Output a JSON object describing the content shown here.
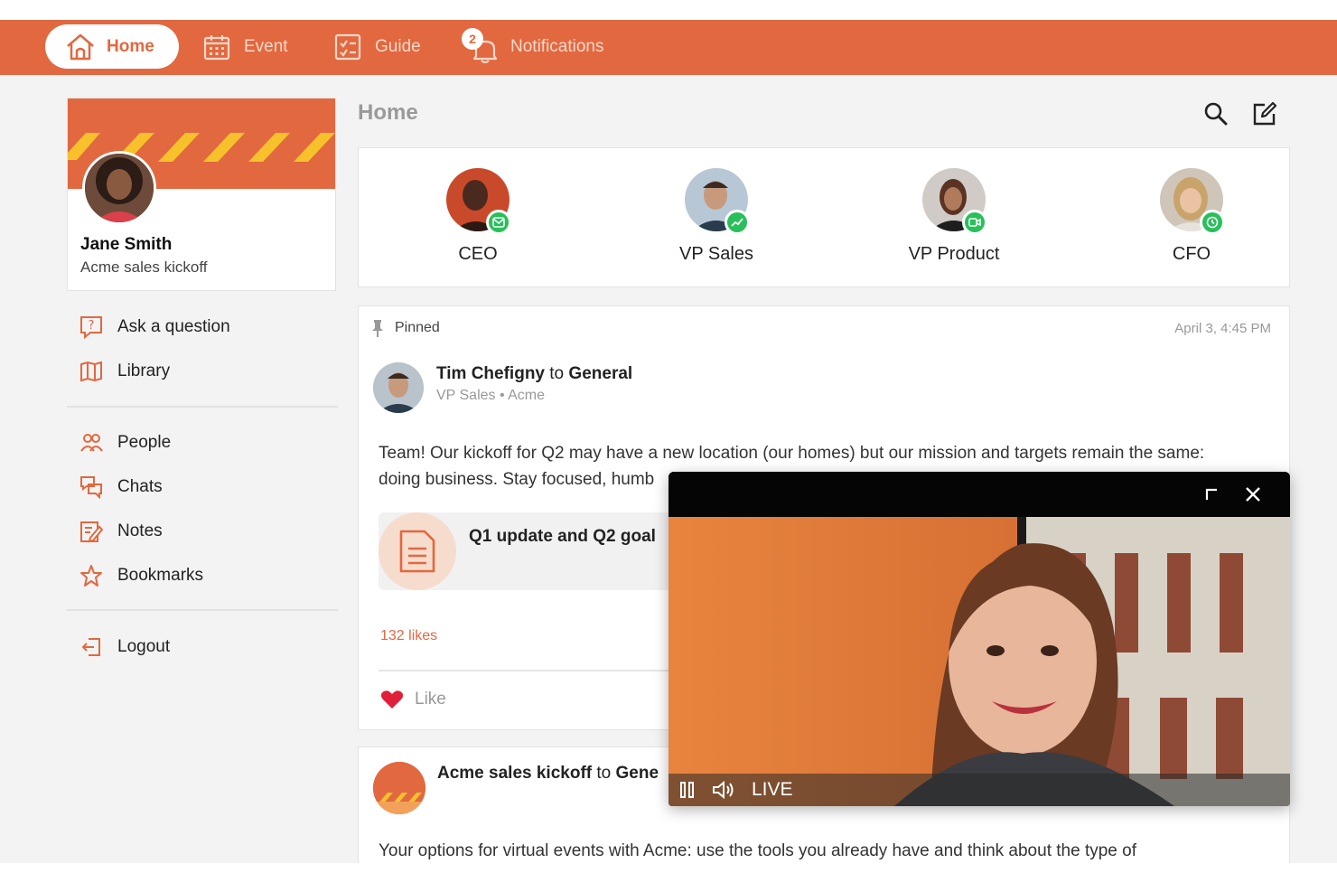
{
  "nav": {
    "home": "Home",
    "event": "Event",
    "guide": "Guide",
    "notifications": "Notifications",
    "notification_count": "2"
  },
  "profile": {
    "name": "Jane Smith",
    "subtitle": "Acme sales kickoff"
  },
  "sidebar": {
    "items": [
      {
        "label": "Ask a question",
        "icon": "question-icon"
      },
      {
        "label": "Library",
        "icon": "book-icon"
      },
      {
        "label": "People",
        "icon": "people-icon"
      },
      {
        "label": "Chats",
        "icon": "chat-icon"
      },
      {
        "label": "Notes",
        "icon": "notes-icon"
      },
      {
        "label": "Bookmarks",
        "icon": "star-icon"
      },
      {
        "label": "Logout",
        "icon": "logout-icon"
      }
    ]
  },
  "main": {
    "title": "Home",
    "search_icon": "search-icon",
    "compose_icon": "compose-icon"
  },
  "leaders": [
    {
      "label": "CEO",
      "status_icon": "mail-icon"
    },
    {
      "label": "VP Sales",
      "status_icon": "trend-icon"
    },
    {
      "label": "VP Product",
      "status_icon": "video-icon"
    },
    {
      "label": "CFO",
      "status_icon": "clock-icon"
    }
  ],
  "post": {
    "pinned_label": "Pinned",
    "date": "April 3, 4:45 PM",
    "author": "Tim Chefigny",
    "to": "to",
    "channel": "General",
    "meta": "VP Sales • Acme",
    "body_line1": "Team! Our kickoff for Q2 may have a new location (our homes) but our mission and targets remain the same:",
    "body_line2": "doing business. Stay focused, humb",
    "attachment_title": "Q1 update and Q2 goal",
    "likes": "132 likes",
    "like_label": "Like"
  },
  "post2": {
    "author": "Acme sales kickoff",
    "to": "to",
    "channel": "Gene",
    "body": "Your options for virtual events with Acme: use the tools you already have and think about the type of"
  },
  "video": {
    "live_label": "LIVE",
    "colors": {
      "accent": "#e26840",
      "status": "#27c05a"
    }
  }
}
